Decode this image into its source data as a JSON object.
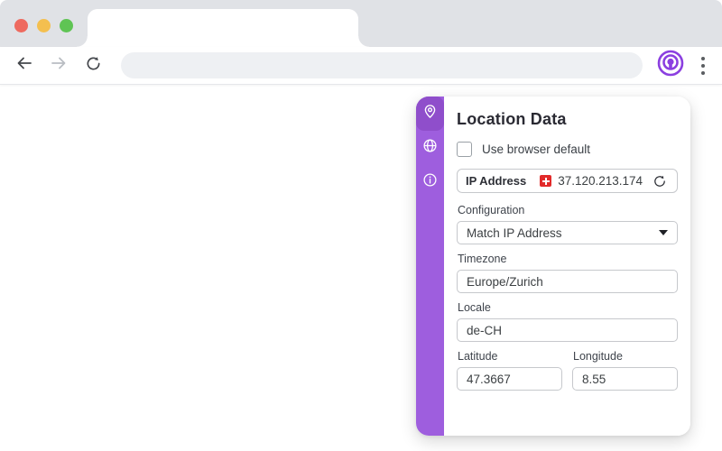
{
  "browser": {
    "tab_title": "",
    "address_value": "",
    "address_placeholder": ""
  },
  "panel": {
    "title": "Location Data",
    "default_checkbox": {
      "label": "Use browser default",
      "checked": false
    },
    "ip": {
      "label": "IP Address",
      "value": "37.120.213.174",
      "country_flag": "switzerland"
    },
    "configuration": {
      "label": "Configuration",
      "value": "Match IP Address"
    },
    "timezone": {
      "label": "Timezone",
      "value": "Europe/Zurich"
    },
    "locale": {
      "label": "Locale",
      "value": "de-CH"
    },
    "latitude": {
      "label": "Latitude",
      "value": "47.3667"
    },
    "longitude": {
      "label": "Longitude",
      "value": "8.55"
    },
    "sidebar": {
      "items": [
        {
          "icon": "location-pin-icon",
          "active": true
        },
        {
          "icon": "globe-icon",
          "active": false
        },
        {
          "icon": "info-icon",
          "active": false
        }
      ]
    }
  },
  "colors": {
    "sidebar_purple": "#9e5ede",
    "active_item_purple": "#8f4ecb",
    "extension_purple": "#8b3fe0",
    "flag_red": "#e22a2a",
    "traffic_red": "#ee6a5f",
    "traffic_yellow": "#f4bf4f",
    "traffic_green": "#5fc454",
    "tabstrip_gray": "#e0e2e6"
  }
}
